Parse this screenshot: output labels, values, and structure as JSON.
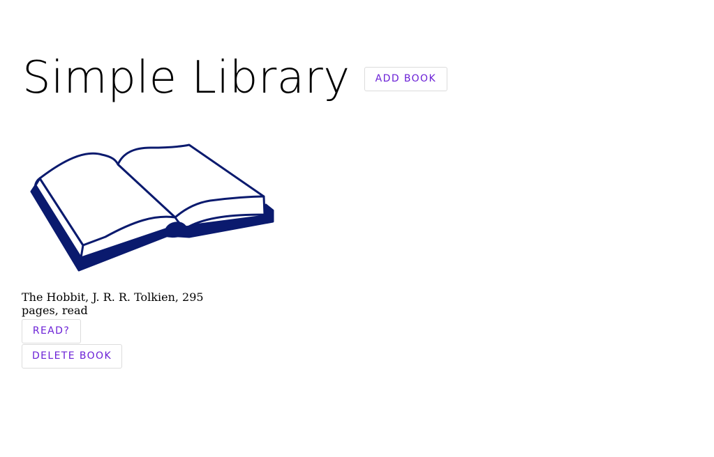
{
  "header": {
    "title": "Simple Library",
    "add_book_label": "ADD BOOK"
  },
  "books": [
    {
      "info": "The Hobbit, J. R. R. Tolkien, 295 pages, read",
      "read_label": "READ?",
      "delete_label": "DELETE BOOK",
      "image_icon": "open-book-icon"
    }
  ],
  "colors": {
    "button_text": "#6a1fd6",
    "book_illustration": "#0a1a6e"
  }
}
